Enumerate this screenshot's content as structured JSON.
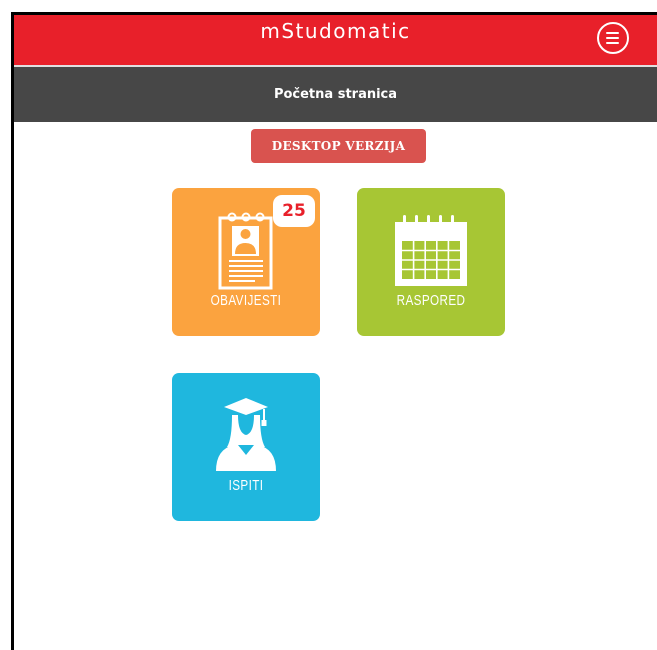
{
  "header": {
    "app_title": "mStudomatic",
    "menu_icon": "menu-icon"
  },
  "subheader": {
    "page_title": "Početna stranica"
  },
  "desktop_button": {
    "label": "DESKTOP VERZIJA"
  },
  "tiles": [
    {
      "label": "OBAVIJESTI",
      "icon": "notice-board-icon",
      "badge": "25",
      "color": "#fba33f"
    },
    {
      "label": "RASPORED",
      "icon": "calendar-icon",
      "color": "#a7c634"
    },
    {
      "label": "ISPITI",
      "icon": "graduate-icon",
      "color": "#1fb7de"
    }
  ],
  "colors": {
    "header_bg": "#e8202a",
    "subheader_bg": "#474747",
    "button_bg": "#d9534f"
  }
}
